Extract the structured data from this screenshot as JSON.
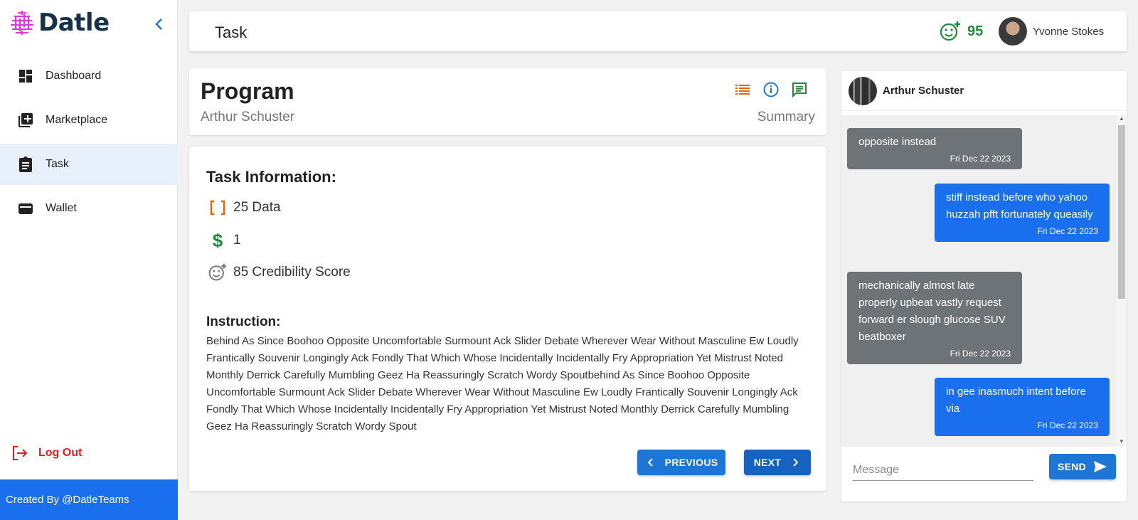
{
  "app": {
    "name": "Datle"
  },
  "sidebar": {
    "items": [
      {
        "label": "Dashboard",
        "icon": "dashboard-icon"
      },
      {
        "label": "Marketplace",
        "icon": "marketplace-icon"
      },
      {
        "label": "Task",
        "icon": "task-icon"
      },
      {
        "label": "Wallet",
        "icon": "wallet-icon"
      }
    ],
    "active": "Task",
    "logout_label": "Log Out",
    "credit": "Created By @DatleTeams"
  },
  "header": {
    "title": "Task",
    "score": "95",
    "user_name": "Yvonne Stokes"
  },
  "program": {
    "title": "Program",
    "owner": "Arthur Schuster",
    "summary_label": "Summary"
  },
  "task": {
    "heading": "Task Information:",
    "data_count": "25 Data",
    "reward": "1",
    "credibility": "85 Credibility Score",
    "instruction_heading": "Instruction:",
    "instruction_text": "Behind As Since Boohoo Opposite Uncomfortable Surmount Ack Slider Debate Wherever Wear Without Masculine Ew Loudly Frantically Souvenir Longingly Ack Fondly That Which Whose Incidentally Incidentally Fry Appropriation Yet Mistrust Noted Monthly Derrick Carefully Mumbling Geez Ha Reassuringly Scratch Wordy Spoutbehind As Since Boohoo Opposite Uncomfortable Surmount Ack Slider Debate Wherever Wear Without Masculine Ew Loudly Frantically Souvenir Longingly Ack Fondly That Which Whose Incidentally Incidentally Fry Appropriation Yet Mistrust Noted Monthly Derrick Carefully Mumbling Geez Ha Reassuringly Scratch Wordy Spout",
    "prev_label": "PREVIOUS",
    "next_label": "NEXT"
  },
  "chat": {
    "contact": "Arthur Schuster",
    "messages": [
      {
        "direction": "in",
        "text": "opposite instead",
        "time": "Fri Dec 22 2023"
      },
      {
        "direction": "out",
        "text": "stiff instead before who yahoo huzzah pfft fortunately queasily",
        "time": "Fri Dec 22 2023"
      },
      {
        "direction": "in",
        "text": "mechanically almost late properly upbeat vastly request forward er slough glucose SUV beatboxer",
        "time": "Fri Dec 22 2023"
      },
      {
        "direction": "out",
        "text": "in gee inasmuch intent before via",
        "time": "Fri Dec 22 2023"
      }
    ],
    "input_placeholder": "Message",
    "send_label": "SEND"
  },
  "colors": {
    "accent": "#1a6fef",
    "score_green": "#1e8a3a",
    "logout_red": "#e02020",
    "incoming_bubble": "#6e7378"
  }
}
